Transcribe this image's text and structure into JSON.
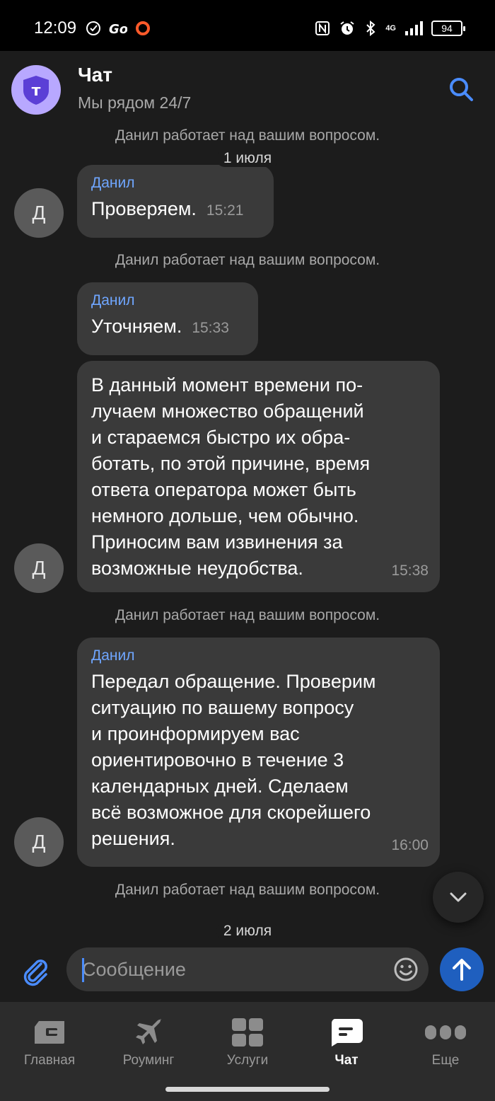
{
  "status_bar": {
    "time": "12:09",
    "battery": "94",
    "network": "4G"
  },
  "header": {
    "title": "Чат",
    "subtitle": "Мы рядом 24/7",
    "logo_letter": "т"
  },
  "chat": {
    "system_notice": "Данил работает над вашим вопросом.",
    "date_1": "1 июля",
    "date_2": "2 июля",
    "messages": [
      {
        "avatar": "Д",
        "author": "Данил",
        "text": "Проверяем.",
        "time": "15:21"
      },
      {
        "author": "Данил",
        "text": "Уточняем.",
        "time": "15:33"
      },
      {
        "avatar": "Д",
        "text": "В данный момент времени по-\nлучаем множество обращений\nи стараемся быстро их обра-\nботать, по этой причине, время\nответа оператора может быть\nнемного дольше, чем обычно.\nПриносим вам извинения за\nвозможные неудобства.",
        "time": "15:38"
      },
      {
        "avatar": "Д",
        "author": "Данил",
        "text": "Передал обращение. Проверим\nситуацию по вашему вопросу\nи проинформируем вас\nориентировочно в течение 3\nкалендарных дней. Сделаем\nвсё возможное для скорейшего\nрешения.",
        "time": "16:00"
      }
    ]
  },
  "composer": {
    "placeholder": "Сообщение"
  },
  "nav": {
    "items": [
      {
        "label": "Главная",
        "icon": "home-icon"
      },
      {
        "label": "Роуминг",
        "icon": "airplane-icon"
      },
      {
        "label": "Услуги",
        "icon": "services-grid-icon"
      },
      {
        "label": "Чат",
        "icon": "chat-icon",
        "active": true
      },
      {
        "label": "Еще",
        "icon": "more-dots-icon"
      }
    ]
  },
  "colors": {
    "accent": "#4a8cff",
    "send_button": "#1f5fbf",
    "author": "#6fa6ff",
    "logo_bg": "#b8a8ff",
    "logo_fg": "#5b3fd6"
  }
}
